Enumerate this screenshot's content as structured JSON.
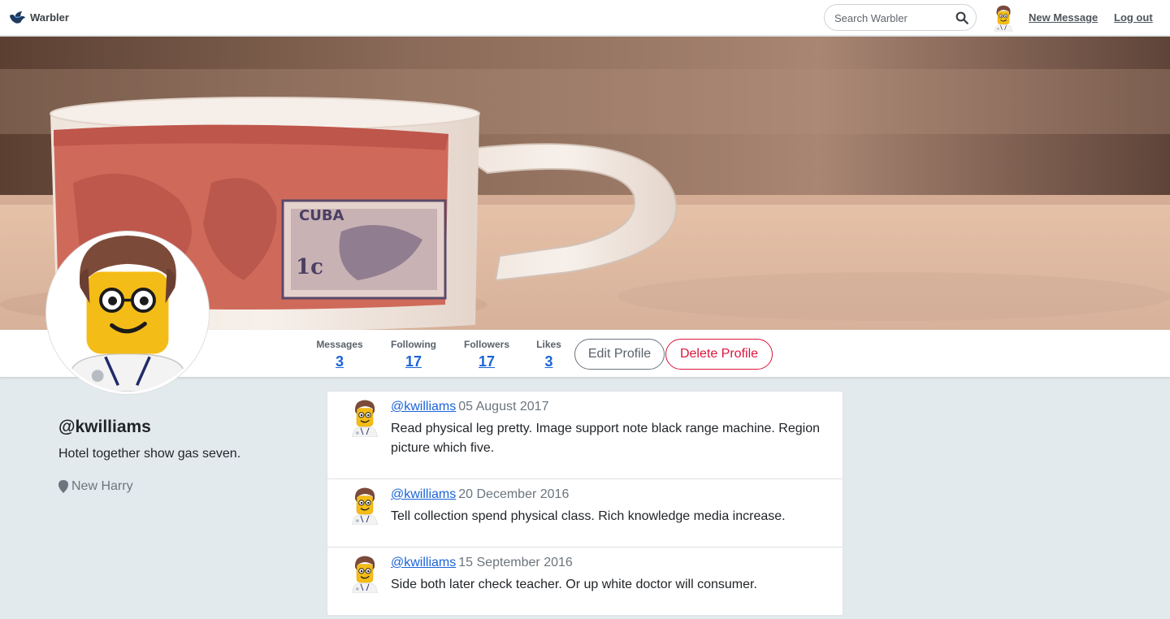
{
  "nav": {
    "brand": "Warbler",
    "search_placeholder": "Search Warbler",
    "new_message": "New Message",
    "logout": "Log out"
  },
  "stats": {
    "messages_label": "Messages",
    "messages_value": "3",
    "following_label": "Following",
    "following_value": "17",
    "followers_label": "Followers",
    "followers_value": "17",
    "likes_label": "Likes",
    "likes_value": "3"
  },
  "actions": {
    "edit": "Edit Profile",
    "delete": "Delete Profile"
  },
  "profile": {
    "username": "@kwilliams",
    "bio": "Hotel together show gas seven.",
    "location": "New Harry"
  },
  "messages": [
    {
      "user": "@kwilliams",
      "date": "05 August 2017",
      "text": "Read physical leg pretty. Image support note black range machine. Region picture which five."
    },
    {
      "user": "@kwilliams",
      "date": "20 December 2016",
      "text": "Tell collection spend physical class. Rich knowledge media increase."
    },
    {
      "user": "@kwilliams",
      "date": "15 September 2016",
      "text": "Side both later check teacher. Or up white doctor will consumer."
    }
  ],
  "hero_cup_text": [
    "CUBA",
    "1c"
  ],
  "colors": {
    "link": "#1b64d8",
    "danger": "#dc143c",
    "page_bg": "#e3eaee"
  },
  "icons": {
    "brand": "bird-icon",
    "search": "search-icon",
    "location": "map-marker-icon"
  }
}
